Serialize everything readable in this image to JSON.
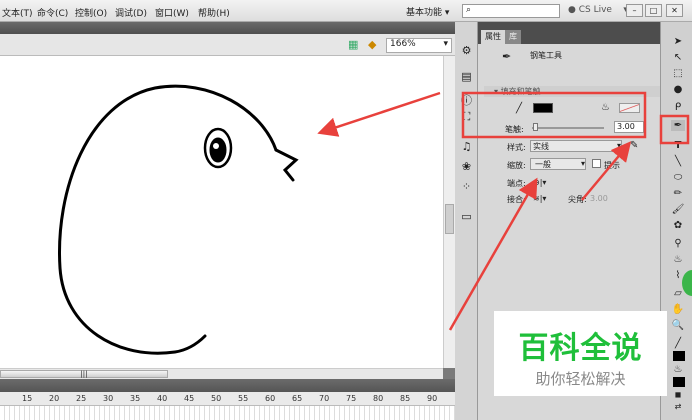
{
  "menu": [
    "文本(T)",
    "命令(C)",
    "控制(O)",
    "调试(D)",
    "窗口(W)",
    "帮助(H)"
  ],
  "workspace": "基本功能 ▾",
  "search_value": "",
  "cslive": "CS Live",
  "zoom": "166%",
  "panel": {
    "tabs": [
      "属性",
      "库"
    ],
    "tool_name": "钢笔工具",
    "section": "填充和笔触",
    "stroke_label": "笔触:",
    "stroke_value": "3.00",
    "stroke_fraction": 0.03,
    "style_label": "样式:",
    "style_value": "实线",
    "scale_label": "缩放:",
    "scale_value": "一般",
    "hint_label": "提示",
    "cap_label": "端点:",
    "join_label": "接合:",
    "miter_label": "尖角:",
    "miter_value": "3.00",
    "stroke_color": "#000000"
  },
  "ruler": [
    "15",
    "20",
    "25",
    "30",
    "35",
    "40",
    "45",
    "50",
    "55",
    "60",
    "65",
    "70",
    "75",
    "80",
    "85",
    "90"
  ],
  "watermark": {
    "title": "百科全说",
    "subtitle": "助你轻松解决",
    "title_color": "#1fbf3a"
  },
  "annotation_color": "#e8413c"
}
